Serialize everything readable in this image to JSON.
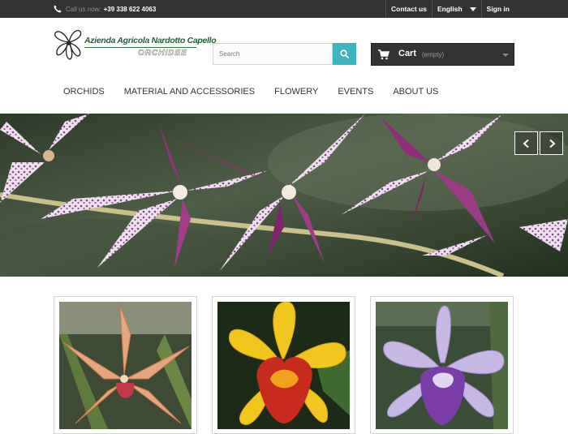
{
  "topbar": {
    "call_label": "Call us now:",
    "phone": "+39 338 622 4063",
    "contact_label": "Contact us",
    "language_label": "English",
    "signin_label": "Sign in"
  },
  "logo": {
    "brand_name": "Azienda Agricola Nardotto Capello",
    "tagline": "ORCHIDEE",
    "brand_color": "#27603a"
  },
  "search": {
    "placeholder": "Search",
    "accent_color": "#3cb5c0"
  },
  "cart": {
    "label": "Cart",
    "status": "(empty)"
  },
  "nav": {
    "items": [
      "ORCHIDS",
      "MATERIAL AND ACCESSORIES",
      "FLOWERY",
      "EVENTS",
      "ABOUT US"
    ]
  },
  "slider": {
    "prev_icon": "chevron-left-icon",
    "next_icon": "chevron-right-icon"
  },
  "products": [
    {
      "icon": "orange-orchid-image"
    },
    {
      "icon": "yellow-orchid-image"
    },
    {
      "icon": "purple-orchid-image"
    }
  ]
}
